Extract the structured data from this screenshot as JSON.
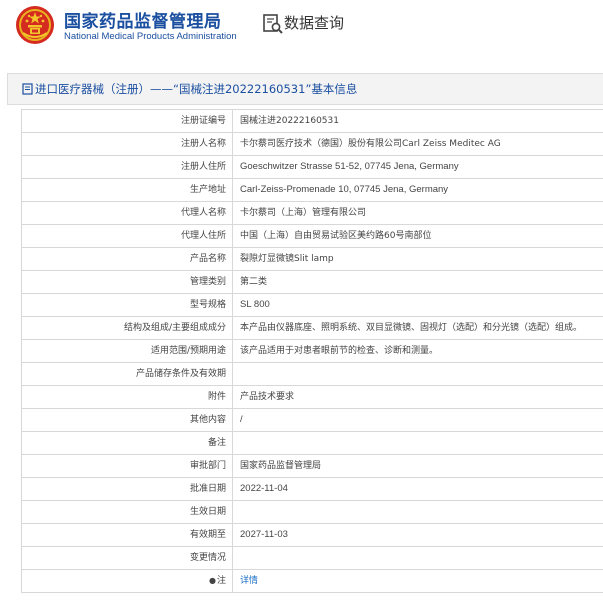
{
  "header": {
    "agency_name_cn": "国家药品监督管理局",
    "agency_name_en": "National Medical Products Administration",
    "query_title": "数据查询",
    "brand_color": "#1b4fa0",
    "emblem_icon": "national-emblem",
    "query_icon": "search-document-icon"
  },
  "title_bar": {
    "text": "进口医疗器械（注册）——“国械注进20222160531”基本信息",
    "icon": "document-icon"
  },
  "rows": [
    {
      "label": "注册证编号",
      "value": "国械注进20222160531"
    },
    {
      "label": "注册人名称",
      "value": "卡尔蔡司医疗技术（德国）股份有限公司Carl Zeiss Meditec AG"
    },
    {
      "label": "注册人住所",
      "value": "Goeschwitzer Strasse 51-52, 07745 Jena, Germany"
    },
    {
      "label": "生产地址",
      "value": "Carl-Zeiss-Promenade 10, 07745 Jena, Germany"
    },
    {
      "label": "代理人名称",
      "value": "卡尔蔡司（上海）管理有限公司"
    },
    {
      "label": "代理人住所",
      "value": "中国（上海）自由贸易试验区美约路60号南部位"
    },
    {
      "label": "产品名称",
      "value": "裂隙灯显微镜Slit lamp"
    },
    {
      "label": "管理类别",
      "value": "第二类"
    },
    {
      "label": "型号规格",
      "value": "SL 800"
    },
    {
      "label": "结构及组成/主要组成成分",
      "value": "本产品由仪器底座、照明系统、双目显微镜、固视灯（选配）和分光镜（选配）组成。"
    },
    {
      "label": "适用范围/预期用途",
      "value": "该产品适用于对患者眼前节的检查、诊断和测量。"
    },
    {
      "label": "产品储存条件及有效期",
      "value": ""
    },
    {
      "label": "附件",
      "value": "产品技术要求"
    },
    {
      "label": "其他内容",
      "value": "/"
    },
    {
      "label": "备注",
      "value": ""
    },
    {
      "label": "审批部门",
      "value": "国家药品监督管理局"
    },
    {
      "label": "批准日期",
      "value": "2022-11-04"
    },
    {
      "label": "生效日期",
      "value": ""
    },
    {
      "label": "有效期至",
      "value": "2027-11-03"
    },
    {
      "label": "变更情况",
      "value": ""
    }
  ],
  "note_row": {
    "dot": "●",
    "label": "注",
    "link_text": "详情",
    "link_color": "#1b6fc4"
  }
}
